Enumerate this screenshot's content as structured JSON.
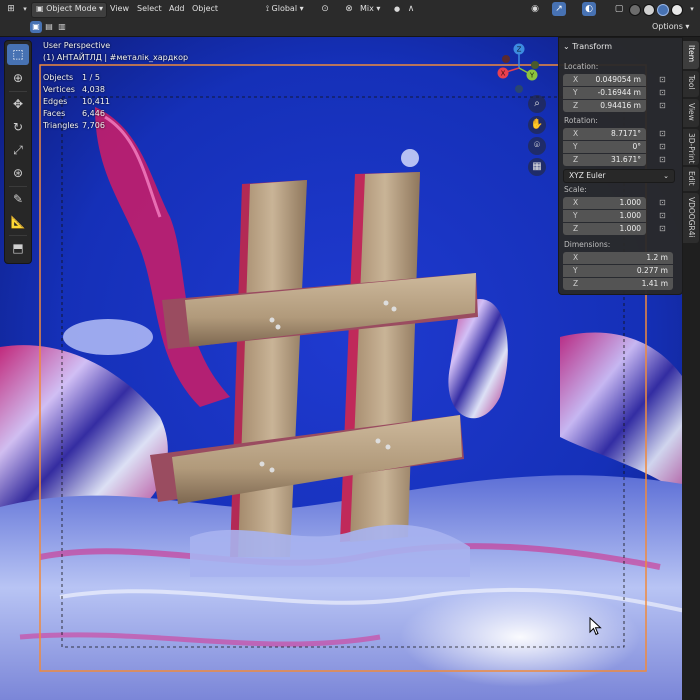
{
  "header": {
    "mode": "Object Mode",
    "menus": [
      "View",
      "Select",
      "Add",
      "Object"
    ],
    "orientation": "Global",
    "pivot": "Mix",
    "options": "Options"
  },
  "viewport": {
    "view_name": "User Perspective",
    "collection_info": "(1) АНТАЙТЛД | #металік_хардкор",
    "stats": [
      {
        "label": "Objects",
        "value": "1 / 5"
      },
      {
        "label": "Vertices",
        "value": "4,038"
      },
      {
        "label": "Edges",
        "value": "10,411"
      },
      {
        "label": "Faces",
        "value": "6,446"
      },
      {
        "label": "Triangles",
        "value": "7,706"
      }
    ],
    "gizmo": {
      "x": "X",
      "y": "Y",
      "z": "Z"
    }
  },
  "sidebar_tabs": [
    "Item",
    "Tool",
    "View",
    "3D-Print",
    "Edit",
    "VDOOGR4i"
  ],
  "transform": {
    "title": "Transform",
    "location_label": "Location:",
    "location": [
      {
        "axis": "X",
        "value": "0.049054 m"
      },
      {
        "axis": "Y",
        "value": "-0.16944 m"
      },
      {
        "axis": "Z",
        "value": "0.94416 m"
      }
    ],
    "rotation_label": "Rotation:",
    "rotation": [
      {
        "axis": "X",
        "value": "8.7171°"
      },
      {
        "axis": "Y",
        "value": "0°"
      },
      {
        "axis": "Z",
        "value": "31.671°"
      }
    ],
    "rotation_mode": "XYZ Euler",
    "scale_label": "Scale:",
    "scale": [
      {
        "axis": "X",
        "value": "1.000"
      },
      {
        "axis": "Y",
        "value": "1.000"
      },
      {
        "axis": "Z",
        "value": "1.000"
      }
    ],
    "dimensions_label": "Dimensions:",
    "dimensions": [
      {
        "axis": "X",
        "value": "1.2 m"
      },
      {
        "axis": "Y",
        "value": "0.277 m"
      },
      {
        "axis": "Z",
        "value": "1.41 m"
      }
    ]
  },
  "colors": {
    "accent": "#4772b3",
    "selection_outline": "#f08a3c",
    "x_axis": "#e8404f",
    "y_axis": "#8cc43e",
    "z_axis": "#3d8be0"
  }
}
